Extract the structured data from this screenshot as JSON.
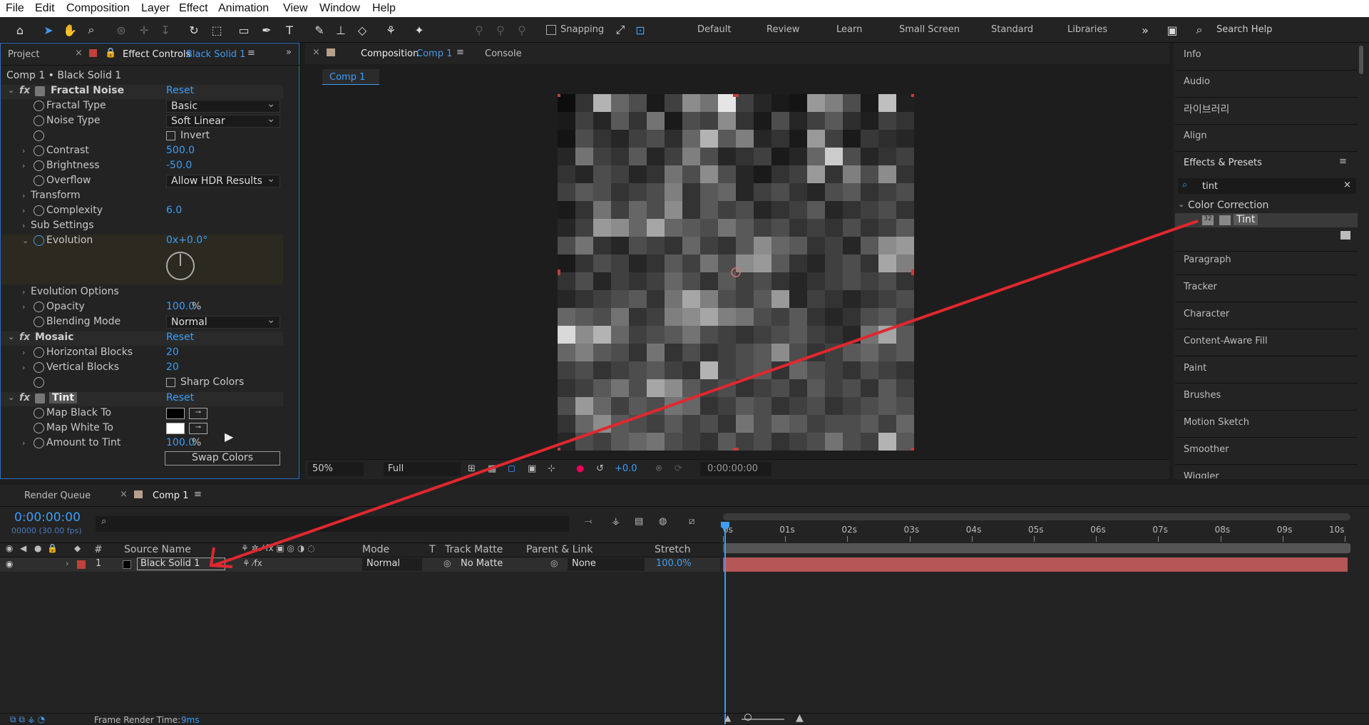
{
  "menu": [
    "File",
    "Edit",
    "Composition",
    "Layer",
    "Effect",
    "Animation",
    "View",
    "Window",
    "Help"
  ],
  "toolbar": {
    "snapping_label": "Snapping",
    "workspaces": [
      "Default",
      "Review",
      "Learn",
      "Small Screen",
      "Standard",
      "Libraries"
    ],
    "search_help_placeholder": "Search Help"
  },
  "effect_controls": {
    "tab_project": "Project",
    "tab_label": "Effect Controls",
    "tab_layer": "Black Solid 1",
    "breadcrumb": "Comp 1 • Black Solid 1",
    "reset": "Reset",
    "fractal_noise": {
      "name": "Fractal Noise",
      "fractal_type_label": "Fractal Type",
      "fractal_type_value": "Basic",
      "noise_type_label": "Noise Type",
      "noise_type_value": "Soft Linear",
      "invert_label": "Invert",
      "contrast_label": "Contrast",
      "contrast_value": "500.0",
      "brightness_label": "Brightness",
      "brightness_value": "-50.0",
      "overflow_label": "Overflow",
      "overflow_value": "Allow HDR Results",
      "transform_label": "Transform",
      "complexity_label": "Complexity",
      "complexity_value": "6.0",
      "sub_settings_label": "Sub Settings",
      "evolution_label": "Evolution",
      "evolution_value": "0x+0.0°",
      "evolution_options_label": "Evolution Options",
      "opacity_label": "Opacity",
      "opacity_value": "100.0",
      "opacity_unit": "%",
      "blending_label": "Blending Mode",
      "blending_value": "Normal"
    },
    "mosaic": {
      "name": "Mosaic",
      "h_blocks_label": "Horizontal Blocks",
      "h_blocks_value": "20",
      "v_blocks_label": "Vertical Blocks",
      "v_blocks_value": "20",
      "sharp_colors_label": "Sharp Colors"
    },
    "tint": {
      "name": "Tint",
      "map_black_label": "Map Black To",
      "map_white_label": "Map White To",
      "amount_label": "Amount to Tint",
      "amount_value": "100.0",
      "amount_unit": "%",
      "swap_label": "Swap Colors"
    }
  },
  "composition": {
    "tab_label": "Composition",
    "tab_comp": "Comp 1",
    "console_tab": "Console",
    "comp_chip": "Comp 1",
    "zoom": "50%",
    "resolution": "Full",
    "exposure": "+0.0",
    "timecode": "0:00:00:00"
  },
  "right_panel": {
    "items_top": [
      "Info",
      "Audio",
      "라이브러리",
      "Align"
    ],
    "effects_presets_title": "Effects & Presets",
    "search_value": "tint",
    "category": "Color Correction",
    "result": "Tint",
    "items_bottom": [
      "Paragraph",
      "Tracker",
      "Character",
      "Content-Aware Fill",
      "Paint",
      "Brushes",
      "Motion Sketch",
      "Smoother",
      "Wiggler"
    ]
  },
  "timeline": {
    "render_queue_tab": "Render Queue",
    "comp_tab": "Comp 1",
    "timecode": "0:00:00:00",
    "frames": "00000 (30.00 fps)",
    "col_source_name": "Source Name",
    "col_mode": "Mode",
    "col_t": "T",
    "col_track_matte": "Track Matte",
    "col_parent": "Parent & Link",
    "col_stretch": "Stretch",
    "col_num": "#",
    "layer_num": "1",
    "layer_name": "Black Solid 1",
    "layer_mode": "Normal",
    "layer_matte": "No Matte",
    "layer_parent": "None",
    "layer_stretch": "100.0%",
    "ruler": [
      "0s",
      "01s",
      "02s",
      "03s",
      "04s",
      "05s",
      "06s",
      "07s",
      "08s",
      "09s",
      "10s"
    ],
    "status_label": "Frame Render Time:",
    "status_value": "9ms"
  },
  "colors": {
    "accent": "#3f9cf2",
    "label_red": "#c2403a",
    "layer_bar": "#b55656",
    "arrow": "#e0282e"
  },
  "mosaic_grid": {
    "cols": 20,
    "rows": 20,
    "levels": [
      5,
      20,
      70,
      40,
      30,
      10,
      25,
      55,
      45,
      90,
      25,
      15,
      10,
      8,
      60,
      50,
      30,
      10,
      75,
      12,
      10,
      25,
      15,
      35,
      20,
      45,
      10,
      30,
      25,
      55,
      20,
      10,
      30,
      15,
      25,
      35,
      18,
      12,
      25,
      20,
      8,
      30,
      20,
      15,
      25,
      30,
      18,
      40,
      70,
      35,
      50,
      15,
      20,
      10,
      60,
      25,
      10,
      22,
      18,
      15,
      15,
      45,
      25,
      20,
      35,
      15,
      25,
      50,
      30,
      15,
      20,
      25,
      10,
      15,
      40,
      80,
      30,
      15,
      20,
      25,
      20,
      15,
      30,
      25,
      15,
      20,
      45,
      30,
      55,
      30,
      15,
      10,
      20,
      25,
      60,
      20,
      50,
      30,
      55,
      20,
      25,
      35,
      30,
      20,
      25,
      30,
      50,
      20,
      35,
      40,
      15,
      25,
      30,
      20,
      15,
      30,
      35,
      20,
      25,
      30,
      10,
      20,
      45,
      25,
      40,
      30,
      55,
      20,
      35,
      25,
      30,
      15,
      20,
      25,
      35,
      15,
      20,
      25,
      30,
      20,
      15,
      25,
      60,
      55,
      40,
      65,
      40,
      35,
      30,
      45,
      35,
      25,
      30,
      20,
      25,
      20,
      30,
      20,
      25,
      35,
      30,
      45,
      20,
      15,
      30,
      25,
      20,
      40,
      25,
      20,
      35,
      55,
      40,
      35,
      20,
      25,
      15,
      35,
      55,
      60,
      10,
      20,
      30,
      25,
      15,
      20,
      35,
      25,
      45,
      30,
      55,
      60,
      35,
      20,
      15,
      25,
      30,
      20,
      65,
      50,
      20,
      30,
      15,
      25,
      20,
      25,
      40,
      30,
      20,
      35,
      25,
      30,
      20,
      15,
      20,
      25,
      30,
      25,
      30,
      20,
      15,
      20,
      25,
      30,
      35,
      20,
      45,
      65,
      50,
      30,
      25,
      35,
      60,
      15,
      25,
      20,
      15,
      20,
      25,
      30,
      40,
      35,
      30,
      45,
      20,
      25,
      50,
      55,
      65,
      50,
      45,
      30,
      25,
      35,
      20,
      15,
      20,
      30,
      35,
      25,
      85,
      55,
      70,
      40,
      25,
      30,
      35,
      45,
      30,
      25,
      20,
      25,
      30,
      35,
      25,
      20,
      15,
      45,
      65,
      35,
      40,
      50,
      35,
      30,
      20,
      45,
      20,
      30,
      20,
      25,
      30,
      35,
      55,
      30,
      20,
      25,
      35,
      40,
      30,
      35,
      25,
      30,
      20,
      25,
      30,
      35,
      25,
      20,
      70,
      25,
      30,
      35,
      20,
      40,
      30,
      25,
      20,
      30,
      25,
      20,
      20,
      25,
      35,
      45,
      30,
      65,
      55,
      35,
      25,
      30,
      20,
      25,
      30,
      20,
      35,
      25,
      30,
      20,
      35,
      25,
      30,
      60,
      40,
      25,
      35,
      30,
      45,
      40,
      20,
      25,
      35,
      30,
      20,
      25,
      30,
      20,
      25,
      30,
      35,
      30,
      20,
      40,
      55,
      35,
      30,
      25,
      35,
      25,
      30,
      20,
      45,
      30,
      40,
      35,
      25,
      30,
      30,
      35,
      25,
      40,
      15,
      30,
      25,
      35,
      40,
      45,
      30,
      25,
      20,
      35,
      25,
      30,
      20,
      25,
      30,
      45,
      30,
      25,
      70,
      35
    ]
  }
}
